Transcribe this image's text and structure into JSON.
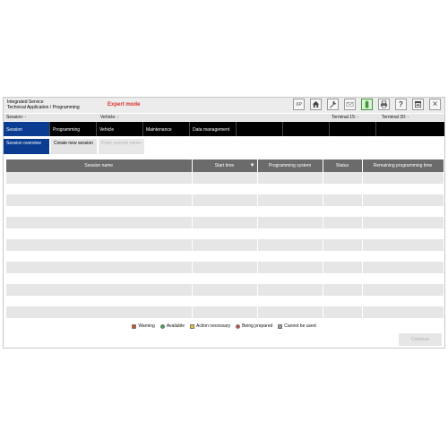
{
  "header": {
    "title_line1": "Integrated Service",
    "title_line2": "Technical Application / Programming",
    "mode": "Expert mode",
    "tools": [
      {
        "name": "xp-icon",
        "label": "XP"
      },
      {
        "name": "home-icon",
        "label": ""
      },
      {
        "name": "wrench-icon",
        "label": ""
      },
      {
        "name": "mail-icon",
        "label": ""
      },
      {
        "name": "battery-icon",
        "label": ""
      },
      {
        "name": "printer-icon",
        "label": ""
      },
      {
        "name": "help-icon",
        "label": "?"
      },
      {
        "name": "window-icon",
        "label": ""
      },
      {
        "name": "close-icon",
        "label": "×"
      }
    ]
  },
  "statusline": {
    "session": "Session:  -",
    "vehicle": "Vehicle:  -",
    "terminal15": "Terminal 15:  -",
    "terminal30": "Terminal 30:  -"
  },
  "menu": [
    "Session",
    "Programming",
    "Vehicle",
    "Maintenance",
    "Data management"
  ],
  "subtabs": [
    "Session overview",
    "Create new session",
    "Enter session name"
  ],
  "table": {
    "columns": [
      "Session name",
      "Start time",
      "Programming system",
      "Status",
      "Remaining programming time"
    ],
    "rows": [
      "",
      "",
      "",
      "",
      "",
      "",
      "",
      "",
      "",
      "",
      "",
      "",
      ""
    ]
  },
  "legend": [
    {
      "label": "Warning",
      "color": "#d64b2a"
    },
    {
      "label": "Available",
      "color": "#39a845"
    },
    {
      "label": "Action necessary",
      "color": "#e8c22c"
    },
    {
      "label": "Being prepared",
      "color": "#c64848"
    },
    {
      "label": "Cannot be used",
      "color": "#999999"
    }
  ],
  "continue_label": "Continue",
  "colors": {
    "accent": "#0a3d91",
    "expert": "#e03030",
    "header_bg": "#6b6b6b"
  }
}
